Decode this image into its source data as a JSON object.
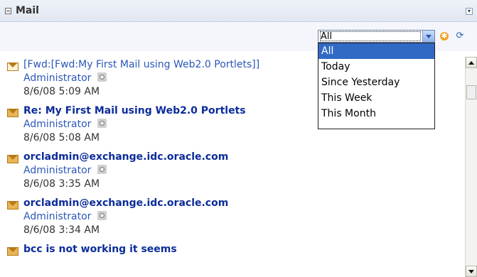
{
  "portlet": {
    "title": "Mail"
  },
  "filter": {
    "selected": "All",
    "options": [
      "All",
      "Today",
      "Since Yesterday",
      "This Week",
      "This Month"
    ]
  },
  "mails": [
    {
      "subject": "[Fwd:[Fwd:My First Mail using Web2.0 Portlets]]",
      "sender": "Administrator",
      "date": "8/6/08 5:09 AM",
      "unread": false
    },
    {
      "subject": "Re: My First Mail using Web2.0 Portlets",
      "sender": "Administrator",
      "date": "8/6/08 5:08 AM",
      "unread": true
    },
    {
      "subject": "orcladmin@exchange.idc.oracle.com",
      "sender": "Administrator",
      "date": "8/6/08 3:35 AM",
      "unread": true
    },
    {
      "subject": "orcladmin@exchange.idc.oracle.com",
      "sender": "Administrator",
      "date": "8/6/08 3:34 AM",
      "unread": true
    },
    {
      "subject": "bcc is not working it seems",
      "sender": "",
      "date": "",
      "unread": true
    }
  ],
  "icons": {
    "collapse": "collapse-icon",
    "menu": "menu-icon",
    "add": "add-icon",
    "refresh": "refresh-icon",
    "envelope": "envelope-icon",
    "presence": "presence-icon"
  },
  "colors": {
    "link": "#2b57b8",
    "unread_link": "#0c2c9a",
    "selection": "#316ac5"
  }
}
